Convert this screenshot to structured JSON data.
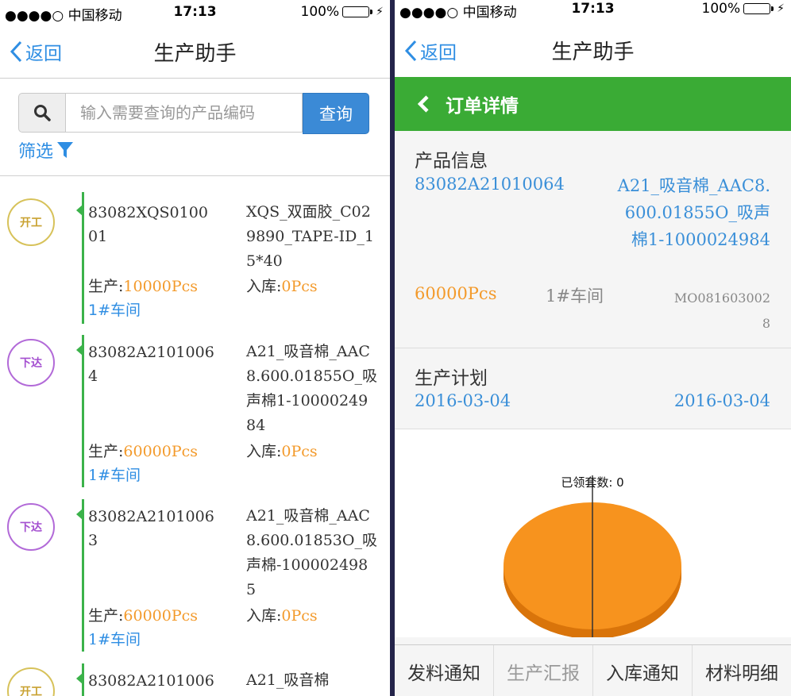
{
  "status": {
    "carrier": "●●●●○ 中国移动",
    "time": "17:13",
    "battery": "100%"
  },
  "left": {
    "nav": {
      "back_label": "返回",
      "title": "生产助手"
    },
    "search": {
      "placeholder": "输入需要查询的产品编码",
      "button_label": "查询"
    },
    "filter_label": "筛选",
    "items": [
      {
        "badge": "开工",
        "badge_type": "kaigong",
        "code": "83082XQS010001",
        "product": "XQS_双面胶_C029890_TAPE-ID_15*40",
        "prod_label": "生产:",
        "prod_qty": "10000Pcs",
        "stock_label": "入库:",
        "stock_qty": "0Pcs",
        "workshop": "1#车间"
      },
      {
        "badge": "下达",
        "badge_type": "xiada",
        "code": "83082A21010064",
        "product": "A21_吸音棉_AAC8.600.01855O_吸声棉1-1000024984",
        "prod_label": "生产:",
        "prod_qty": "60000Pcs",
        "stock_label": "入库:",
        "stock_qty": "0Pcs",
        "workshop": "1#车间"
      },
      {
        "badge": "下达",
        "badge_type": "xiada",
        "code": "83082A21010063",
        "product": "A21_吸音棉_AAC8.600.01853O_吸声棉-1000024985",
        "prod_label": "生产:",
        "prod_qty": "60000Pcs",
        "stock_label": "入库:",
        "stock_qty": "0Pcs",
        "workshop": "1#车间"
      },
      {
        "badge": "开工",
        "badge_type": "kaigong",
        "code": "83082A2101006",
        "product": "A21_吸音棉"
      }
    ]
  },
  "right": {
    "nav": {
      "back_label": "返回",
      "title": "生产助手"
    },
    "header_title": "订单详情",
    "product_info": {
      "title": "产品信息",
      "code": "83082A21010064",
      "name": "A21_吸音棉_AAC8.600.01855O_吸声棉1-1000024984",
      "qty": "60000Pcs",
      "workshop": "1#车间",
      "order_no": "MO0816030028"
    },
    "plan": {
      "title": "生产计划",
      "start": "2016-03-04",
      "end": "2016-03-04"
    },
    "tabs": [
      {
        "label": "发料通知",
        "enabled": true
      },
      {
        "label": "生产汇报",
        "enabled": false
      },
      {
        "label": "入库通知",
        "enabled": true
      },
      {
        "label": "材料明细",
        "enabled": true
      }
    ]
  },
  "chart_data": {
    "type": "pie",
    "categories": [
      "已领套数"
    ],
    "values": [
      0
    ],
    "annotations": [
      "已领套数: 0"
    ],
    "colors": [
      "#f7931e"
    ]
  }
}
